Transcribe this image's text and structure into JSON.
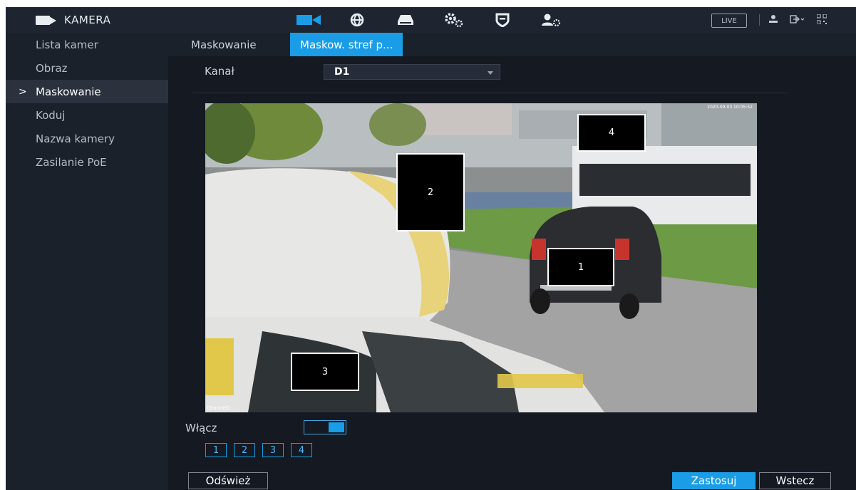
{
  "app": {
    "title": "KAMERA"
  },
  "topbar": {
    "icons": [
      "camera-icon",
      "network-icon",
      "storage-icon",
      "settings-icon",
      "security-icon",
      "account-icon"
    ],
    "live_label": "LIVE",
    "right_icons": [
      "user-icon",
      "logout-icon",
      "qr-icon"
    ]
  },
  "sidebar": {
    "items": [
      {
        "label": "Lista kamer",
        "active": false
      },
      {
        "label": "Obraz",
        "active": false
      },
      {
        "label": "Maskowanie",
        "active": true
      },
      {
        "label": "Koduj",
        "active": false
      },
      {
        "label": "Nazwa kamery",
        "active": false
      },
      {
        "label": "Zasilanie PoE",
        "active": false
      }
    ],
    "active_marker": ">"
  },
  "tabs": [
    {
      "label": "Maskowanie",
      "active": false
    },
    {
      "label": "Maskow. stref p...",
      "active": true
    }
  ],
  "channel": {
    "label": "Kanał",
    "value": "D1"
  },
  "preview": {
    "channel_label": "Channel1",
    "timestamp": "2020-09-03 10:05:52",
    "masks": [
      {
        "number": "1"
      },
      {
        "number": "2"
      },
      {
        "number": "3"
      },
      {
        "number": "4"
      }
    ]
  },
  "enable": {
    "label": "Włącz",
    "on": true
  },
  "zone_buttons": [
    "1",
    "2",
    "3",
    "4"
  ],
  "footer": {
    "refresh_label": "Odśwież",
    "apply_label": "Zastosuj",
    "back_label": "Wstecz"
  },
  "colors": {
    "accent": "#1a9de6",
    "background": "#141922",
    "sidebar": "#1b212b",
    "active_item": "#2b323e"
  }
}
